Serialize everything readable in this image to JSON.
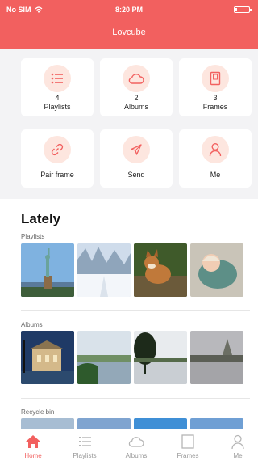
{
  "status_bar": {
    "carrier": "No SIM",
    "time": "8:20 PM",
    "battery_level": 0.15
  },
  "app_title": "Lovcube",
  "tiles": [
    {
      "count": "4",
      "label": "Playlists",
      "icon": "list-icon"
    },
    {
      "count": "2",
      "label": "Albums",
      "icon": "cloud-icon"
    },
    {
      "count": "3",
      "label": "Frames",
      "icon": "frame-icon"
    },
    {
      "count": "",
      "label": "Pair frame",
      "icon": "link-icon"
    },
    {
      "count": "",
      "label": "Send",
      "icon": "send-icon"
    },
    {
      "count": "",
      "label": "Me",
      "icon": "person-icon"
    }
  ],
  "lately": {
    "title": "Lately",
    "sections": [
      {
        "label": "Playlists"
      },
      {
        "label": "Albums"
      },
      {
        "label": "Recycle bin"
      }
    ]
  },
  "tabbar": {
    "tabs": [
      {
        "label": "Home",
        "icon": "home-icon",
        "active": true
      },
      {
        "label": "Playlists",
        "icon": "list-icon"
      },
      {
        "label": "Albums",
        "icon": "cloud-icon"
      },
      {
        "label": "Frames",
        "icon": "frame-icon"
      },
      {
        "label": "Me",
        "icon": "person-icon"
      }
    ]
  },
  "colors": {
    "accent": "#f2605f",
    "icon_bg": "#fde6df",
    "background": "#f3f3f5"
  }
}
